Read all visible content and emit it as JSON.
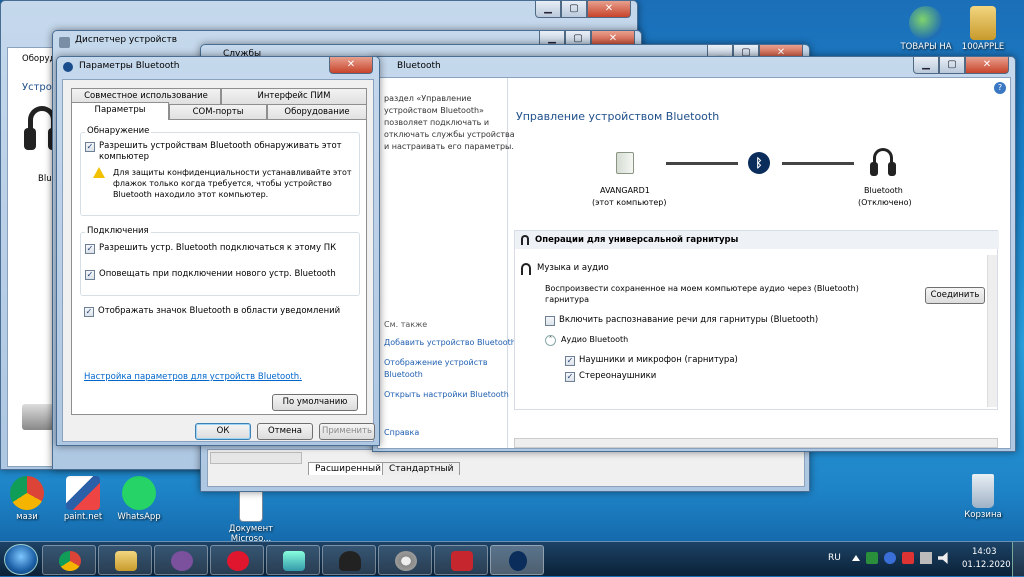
{
  "desktop": {
    "icons": [
      {
        "label": "ТОВАРЫ НА",
        "icon": "globe-icon"
      },
      {
        "label": "100APPLE",
        "icon": "folder-icon"
      },
      {
        "label": "мази",
        "icon": "chrome-icon"
      },
      {
        "label": "paint.net",
        "icon": "paint-icon"
      },
      {
        "label": "WhatsApp",
        "icon": "whatsapp-icon"
      },
      {
        "label": "Документ Microso...",
        "icon": "document-icon"
      },
      {
        "label": "Корзина",
        "icon": "recycle-bin-icon"
      }
    ]
  },
  "back_window": {
    "address_item": "Оборудование и звук",
    "left_label": "Устро",
    "device_label": "Blue"
  },
  "device_manager": {
    "title": "Диспетчер устройств"
  },
  "services": {
    "title": "Службы",
    "tabs": [
      "Расширенный",
      "Стандартный"
    ]
  },
  "bt_main": {
    "title": "Bluetooth",
    "left_text": [
      "раздел «Управление",
      "устройством Bluetooth»",
      "позволяет подключать и",
      "отключать службы устройства",
      "и настраивать его параметры."
    ],
    "see_also": "См. также",
    "links": [
      "Добавить устройство Bluetooth",
      "Отображение устройств",
      "Bluetooth",
      "Открыть настройки Bluetooth"
    ],
    "help": "Справка",
    "heading": "Управление устройством Bluetooth",
    "computer_name": "AVANGARD1",
    "computer_sub": "(этот компьютер)",
    "device_name": "Bluetooth",
    "device_state": "(Отключено)",
    "section1": "Операции для универсальной гарнитуры",
    "section2": "Музыка и аудио",
    "music_desc": "Воспроизвести сохраненное на моем компьютере аудио через (Bluetooth) гарнитура",
    "connect": "Соединить",
    "speech_option": "Включить распознавание речи для гарнитуры (Bluetooth)",
    "audio_group": "Аудио Bluetooth",
    "opt_headset": "Наушники и микрофон (гарнитура)",
    "opt_stereo": "Стереонаушники"
  },
  "bt_dialog": {
    "title": "Параметры Bluetooth",
    "tabs_row1": [
      "Совместное использование",
      "Интерфейс ПИМ"
    ],
    "tabs_row2": [
      "Параметры",
      "COM-порты",
      "Оборудование"
    ],
    "discovery_label": "Обнаружение",
    "discovery_check": "Разрешить устройствам Bluetooth обнаруживать этот компьютер",
    "warning": "Для защиты конфиденциальности устанавливайте этот флажок только когда требуется, чтобы устройство Bluetooth находило этот компьютер.",
    "connections_label": "Подключения",
    "conn_check1": "Разрешить устр. Bluetooth подключаться к этому ПК",
    "conn_check2": "Оповещать при подключении нового устр. Bluetooth",
    "tray_check": "Отображать значок Bluetooth в области уведомлений",
    "settings_link": "Настройка параметров для устройств Bluetooth.",
    "default_btn": "По умолчанию",
    "ok": "ОК",
    "cancel": "Отмена",
    "apply": "Применить"
  },
  "tray": {
    "lang": "RU",
    "time": "14:03",
    "date": "01.12.2020"
  },
  "colors": {
    "accent": "#1f5fb0",
    "heading": "#1e4f8a"
  }
}
